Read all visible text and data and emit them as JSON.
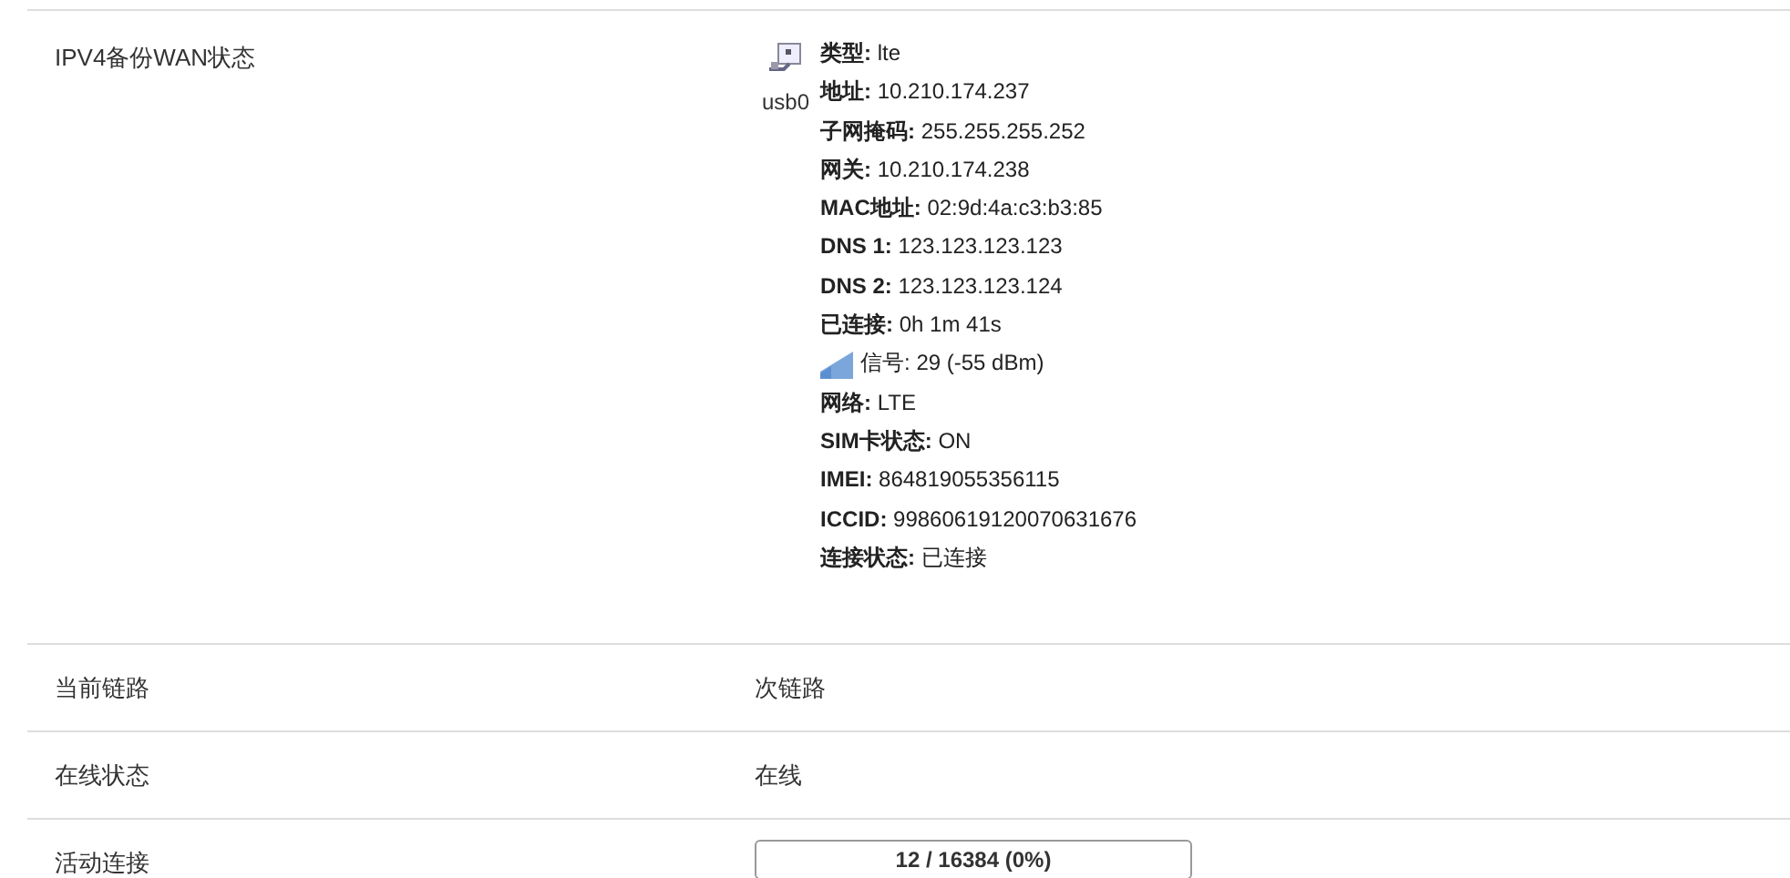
{
  "rows": [
    {
      "label": "IPV4备份WAN状态",
      "kind": "interface",
      "device": "usb0",
      "details": [
        {
          "kind": "text",
          "text": "**类型:** lte"
        },
        {
          "kind": "text",
          "text": "**地址:** 10.210.174.237"
        },
        {
          "kind": "text",
          "text": "**子网掩码:** 255.255.255.252"
        },
        {
          "kind": "text",
          "text": "**网关:** 10.210.174.238"
        },
        {
          "kind": "text",
          "text": "**MAC地址:** 02:9d:4a:c3:b3:85"
        },
        {
          "kind": "text",
          "text": "**DNS 1:** 123.123.123.123"
        },
        {
          "kind": "text",
          "text": "**DNS 2:** 123.123.123.124"
        },
        {
          "kind": "text",
          "text": "**已连接:** 0h 1m 41s"
        },
        {
          "kind": "signal",
          "text": "信号: 29 (-55 dBm)"
        },
        {
          "kind": "text",
          "text": "**网络:** LTE"
        },
        {
          "kind": "text",
          "text": "**SIM卡状态:** ON"
        },
        {
          "kind": "text",
          "text": "**IMEI:** 864819055356115"
        },
        {
          "kind": "text",
          "text": "**ICCID:** 99860619120070631676"
        },
        {
          "kind": "text",
          "text": "**连接状态:** 已连接"
        }
      ]
    },
    {
      "label": "当前链路",
      "kind": "text",
      "value": "次链路"
    },
    {
      "label": "在线状态",
      "kind": "text",
      "value": "在线"
    },
    {
      "label": "活动连接",
      "kind": "meter",
      "value": "12 / 16384 (0%)",
      "level": 0
    }
  ]
}
